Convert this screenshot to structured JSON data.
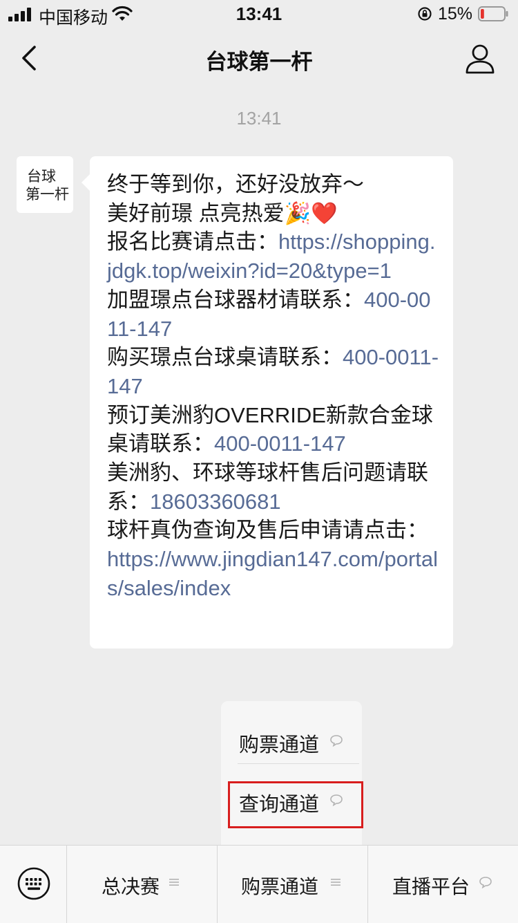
{
  "status_bar": {
    "carrier": "中国移动",
    "time": "13:41",
    "battery_percent": "15%",
    "battery_level": 0.15,
    "icons": [
      "signal-icon",
      "wifi-icon",
      "rotation-lock-icon",
      "battery-icon"
    ]
  },
  "nav": {
    "title": "台球第一杆",
    "back_icon": "chevron-left-icon",
    "profile_icon": "person-icon"
  },
  "chat": {
    "timestamp": "13:41",
    "avatar_text_top": "台球",
    "avatar_text_bottom": "第一杆",
    "message": {
      "line1": "终于等到你，还好没放弃～",
      "line2_text": "美好前璟 点亮热爱",
      "line2_emoji": "🎉❤️",
      "signup_label": "报名比赛请点击：",
      "signup_url": "https://shopping.jdgk.top/weixin?id=20&type=1",
      "franchise_label": "加盟璟点台球器材请联系：",
      "franchise_phone": "400-0011-147",
      "buy_label": "购买璟点台球桌请联系：",
      "buy_phone": "400-0011-147",
      "reserve_label": "预订美洲豹OVERRIDE新款合金球桌请联系：",
      "reserve_phone": "400-0011-147",
      "aftersale_label": "美洲豹、环球等球杆售后问题请联系：",
      "aftersale_phone": "18603360681",
      "verify_label": "球杆真伪查询及售后申请请点击：",
      "verify_url": "https://www.jingdian147.com/portals/sales/index"
    }
  },
  "submenu": {
    "items": [
      {
        "label": "购票通道",
        "icon": "speech-bubble-icon"
      },
      {
        "label": "查询通道",
        "icon": "speech-bubble-icon"
      }
    ],
    "highlight_color": "#d81e1e"
  },
  "bottom_menu": {
    "keyboard_icon": "keyboard-icon",
    "tabs": [
      {
        "label": "总决赛",
        "icon": "menu-lines-icon"
      },
      {
        "label": "购票通道",
        "icon": "menu-lines-icon"
      },
      {
        "label": "直播平台",
        "icon": "speech-bubble-icon"
      }
    ]
  },
  "colors": {
    "background": "#ededed",
    "link": "#576b95",
    "bubble": "#ffffff",
    "battery_low": "#e5322d"
  }
}
